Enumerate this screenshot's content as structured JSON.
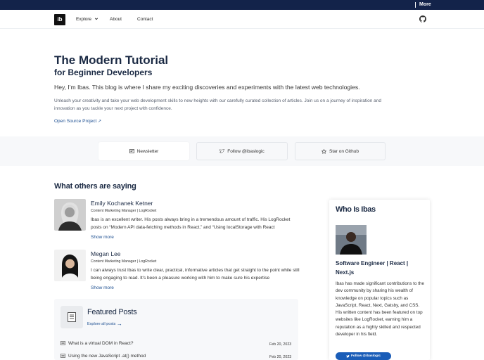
{
  "topbar": {
    "more_label": "More"
  },
  "nav": {
    "logo_text": "ib",
    "links": [
      {
        "label": "Explore"
      },
      {
        "label": "About"
      },
      {
        "label": "Contact"
      }
    ],
    "github_icon": "github-icon"
  },
  "hero": {
    "title": "The Modern Tutorial",
    "subtitle": "for Beginner Developers",
    "intro": "Hey, I'm Ibas. This blog is where I share my exciting discoveries and experiments with the latest web technologies.",
    "description": "Unleash your creativity and take your web development skills to new heights with our carefully curated collection of articles. Join us on a journey of inspiration and innovation as you tackle your next project with confidence.",
    "oss_link": "Open Source Project"
  },
  "actions": [
    {
      "label": "Newsletter",
      "icon": "newsletter-icon"
    },
    {
      "label": "Follow @ibaslogic",
      "icon": "twitter-icon"
    },
    {
      "label": "Star on Github",
      "icon": "star-icon"
    }
  ],
  "testimonials": {
    "title": "What others are saying",
    "items": [
      {
        "name": "Emily Kochanek Ketner",
        "role": "Content Marketing Manager | LogRocket",
        "body": "Ibas is an excellent writer. His posts always bring in a tremendous amount of traffic. His LogRocket posts on “Modern API data-fetching methods in React,” and “Using localStorage with React",
        "more": "Show more"
      },
      {
        "name": "Megan Lee",
        "role": "Content Marketing Manager | LogRocket",
        "body": "I can always trust Ibas to write clear, practical, informative articles that get straight to the point while still being engaging to read. It's been a pleasure working with him to make sure his expertise",
        "more": "Show more"
      }
    ]
  },
  "featured": {
    "title": "Featured Posts",
    "explore": "Explore all posts",
    "posts": [
      {
        "title": "What is a virtual DOM in React?",
        "date": "Feb 20, 2023"
      },
      {
        "title": "Using the new JavaScript .at() method",
        "date": "Feb 20, 2023"
      }
    ]
  },
  "about": {
    "title": "Who Is Ibas",
    "role": "Software Engineer | React | Next.js",
    "bio": "Ibas has made significant contributions to the dev community by sharing his wealth of knowledge on popular topics such as JavaScript, React, Next, Gatsby, and CSS. His written content has been featured on top websites like LogRocket, earning him a reputation as a highly skilled and respected developer in his field.",
    "follow": "Follow @ibaslogic"
  },
  "colors": {
    "topbar": "#13234a",
    "link": "#1d4f91",
    "button": "#1a5db8",
    "heading": "#1b2a44"
  }
}
